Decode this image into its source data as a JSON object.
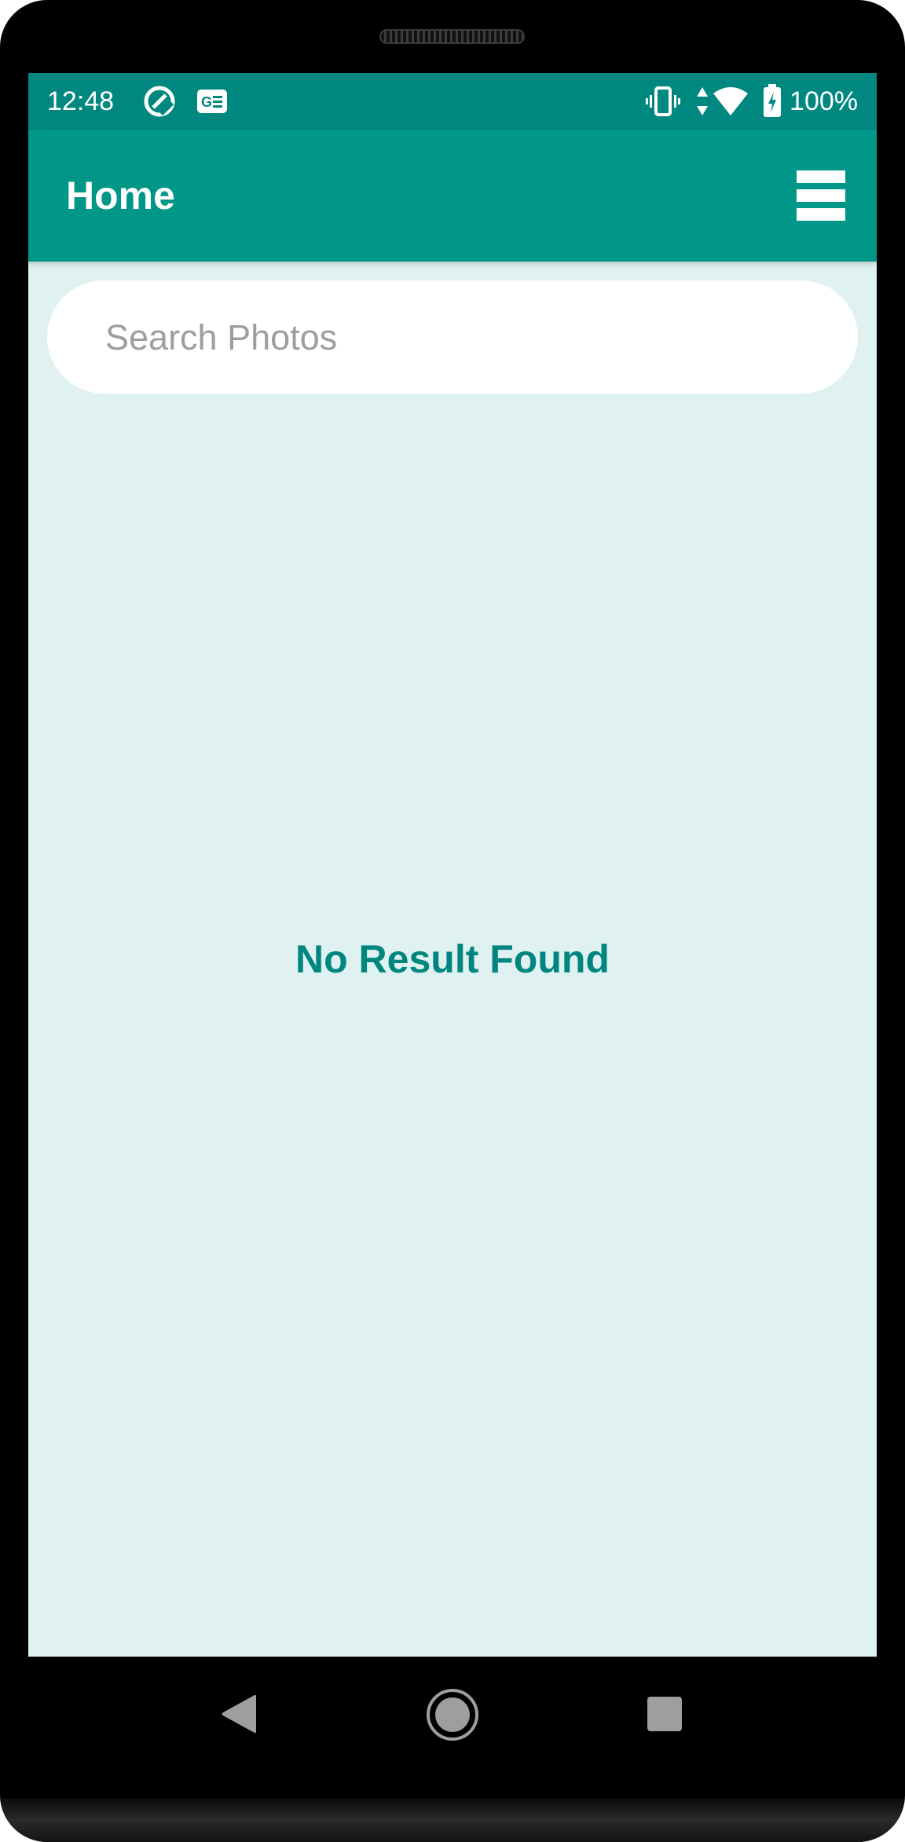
{
  "status_bar": {
    "time": "12:48",
    "battery": "100%",
    "icons": [
      "sync-icon",
      "news-icon",
      "vibrate-icon",
      "data-arrows-icon",
      "wifi-icon",
      "battery-charging-icon"
    ]
  },
  "app_bar": {
    "title": "Home",
    "menu_icon": "hamburger-menu-icon"
  },
  "search": {
    "value": "",
    "placeholder": "Search Photos"
  },
  "content": {
    "empty_message": "No Result Found"
  },
  "nav_bar": {
    "buttons": [
      "back-icon",
      "home-icon",
      "recents-icon"
    ]
  },
  "colors": {
    "status_bar": "#00877f",
    "app_bar": "#009688",
    "background": "#dff1f0",
    "accent_text": "#00867f"
  }
}
